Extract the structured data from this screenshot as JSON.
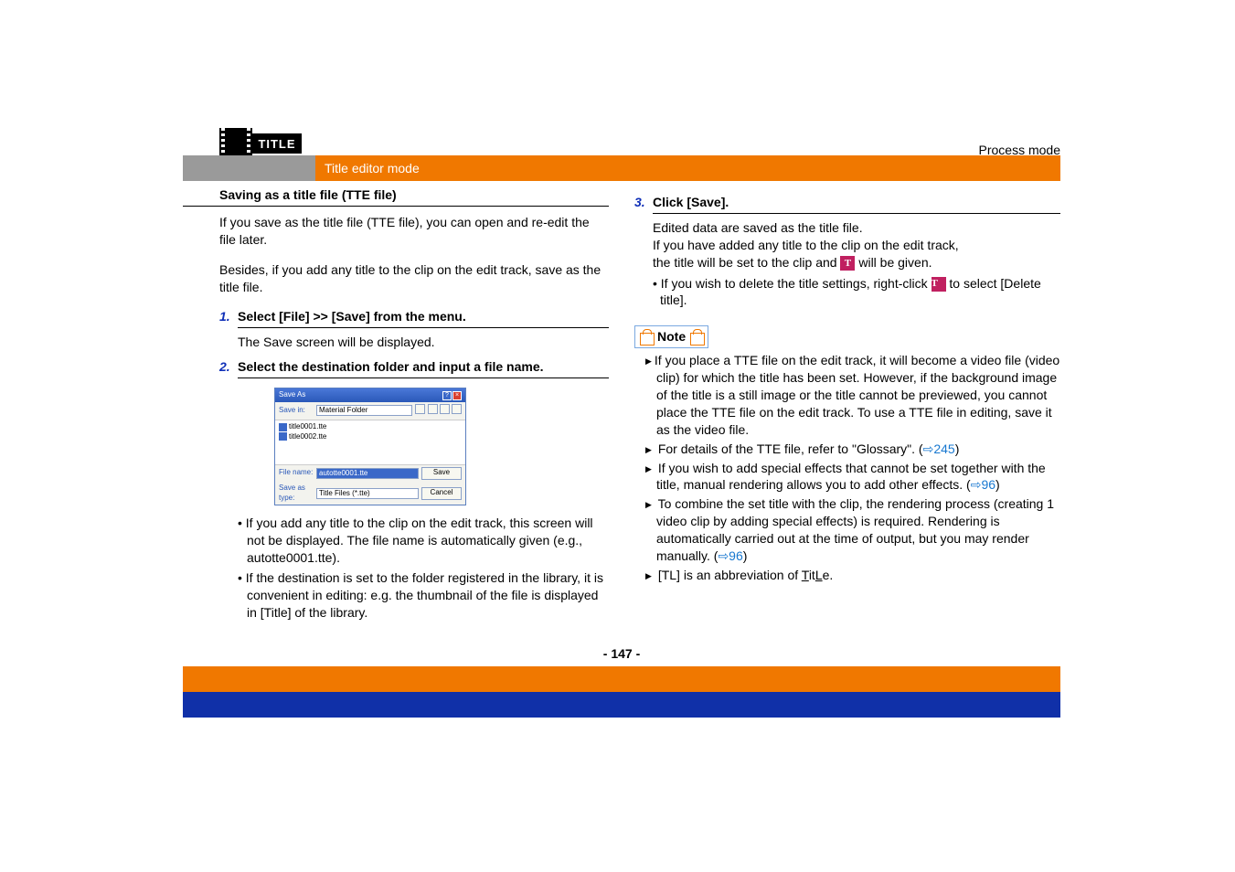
{
  "header": {
    "title_logo": "TITLE",
    "process_mode": "Process mode",
    "mode_label": "Title editor mode"
  },
  "left": {
    "section_title": "Saving as a title file (TTE file)",
    "intro_p1": "If you save as the title file (TTE file), you can open and re-edit the file later.",
    "intro_p2": "Besides, if you add any title to the clip on the edit track, save as the title file.",
    "step1_num": "1.",
    "step1_text": "Select [File] >> [Save] from the menu.",
    "step1_sub": "The Save screen will be displayed.",
    "step2_num": "2.",
    "step2_text": "Select the destination folder and input a file name.",
    "dialog": {
      "title": "Save As",
      "savein_label": "Save in:",
      "savein_value": "Material Folder",
      "list_items": [
        "title0001.tte",
        "title0002.tte"
      ],
      "filename_label": "File name:",
      "filename_value": "autotte0001.tte",
      "type_label": "Save as type:",
      "type_value": "Title Files (*.tte)",
      "save_btn": "Save",
      "cancel_btn": "Cancel"
    },
    "bullet1": "If you add any title to the clip on the edit track, this screen will not be displayed. The file name is automatically given (e.g., autotte0001.tte).",
    "bullet2": "If the destination is set to the folder registered in the library, it is convenient in editing: e.g. the thumbnail of the file is displayed in [Title] of the library."
  },
  "right": {
    "step3_num": "3.",
    "step3_text": "Click [Save].",
    "step3_line1": "Edited data are saved as the title file.",
    "step3_line2": "If you have added any title to the clip on the edit track,",
    "step3_line3a": "the title will be set to the clip and ",
    "step3_line3b": " will be given.",
    "step3_bullet_a": "If you wish to delete the title settings, right-click ",
    "step3_bullet_b": " to select [Delete title].",
    "note_label": "Note",
    "note1": "If you place a TTE file on the edit track, it will become a video file (video clip) for which the title has been set. However, if the background image of the title is a still image or the title cannot be previewed, you cannot place the TTE file on the edit track. To use a TTE file in editing, save it as the video file.",
    "note2_a": "For details of the TTE file, refer to \"Glossary\". (",
    "note2_link": "245",
    "note2_b": ")",
    "note3_a": "If you wish to add special effects that cannot be set together with the title, manual rendering allows you to add other effects. (",
    "note3_link": "96",
    "note3_b": ")",
    "note4_a": "To combine the set title with the clip, the rendering process (creating 1 video clip by adding special effects) is required. Rendering is automatically carried out at the time of output, but you may render manually. (",
    "note4_link": "96",
    "note4_b": ")",
    "note5_a": "[TL] is an abbreviation of ",
    "note5_b": "it",
    "note5_c": "e."
  },
  "page_number": "- 147 -"
}
